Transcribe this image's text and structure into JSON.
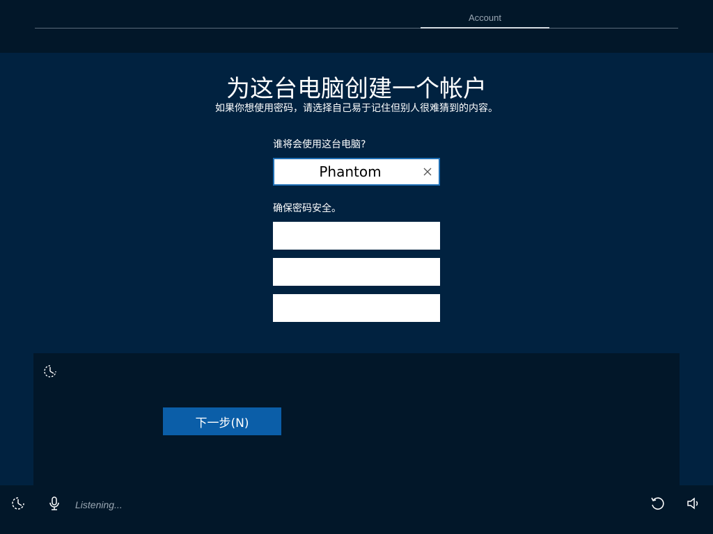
{
  "header": {
    "step_label": "Account"
  },
  "main": {
    "title": "为这台电脑创建一个帐户",
    "subtitle": "如果你想使用密码，请选择自己易于记住但别人很难猜到的内容。",
    "username_label": "谁将会使用这台电脑?",
    "username_value": "Phantom",
    "password_label": "确保密码安全。",
    "password_value": "",
    "confirm_password_value": "",
    "hint_value": ""
  },
  "panel": {
    "next_button_label": "下一步(N)"
  },
  "footer": {
    "listening_text": "Listening..."
  },
  "icons": [
    "ease-of-access-icon",
    "clear-icon",
    "microphone-icon",
    "restart-icon",
    "volume-icon"
  ],
  "colors": {
    "background": "#012240",
    "dark_band": "#021729",
    "accent": "#0b5ea8",
    "focus_border": "#1f6fb5"
  }
}
